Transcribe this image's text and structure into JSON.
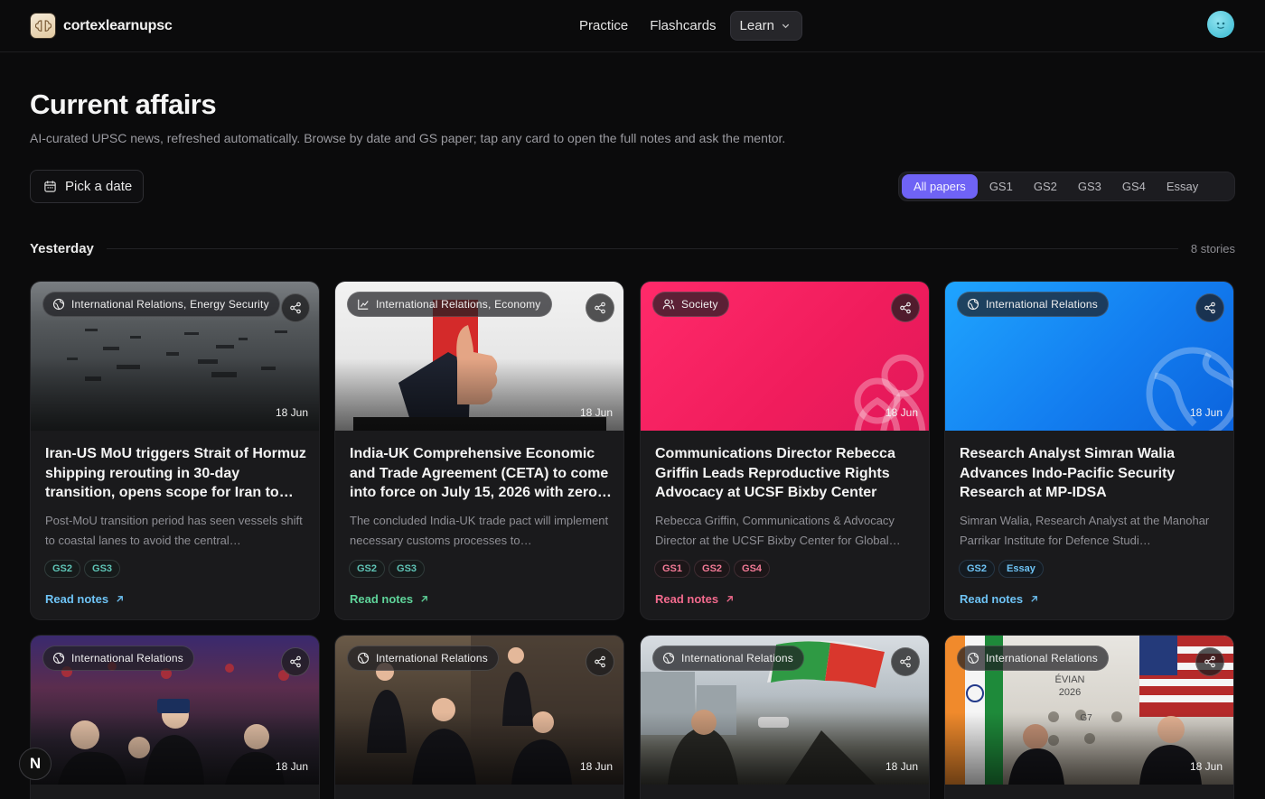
{
  "nav": {
    "brand": "cortexlearnupsc",
    "items": [
      "Practice",
      "Flashcards"
    ],
    "learn_label": "Learn"
  },
  "header": {
    "title": "Current affairs",
    "subtitle": "AI-curated UPSC news, refreshed automatically. Browse by date and GS paper; tap any card to open the full notes and ask the mentor.",
    "pick_date": "Pick a date"
  },
  "filters": [
    "All papers",
    "GS1",
    "GS2",
    "GS3",
    "GS4",
    "Essay"
  ],
  "section": {
    "title": "Yesterday",
    "count": "8 stories"
  },
  "cards": [
    {
      "tag": "International Relations, Energy Security",
      "date": "18 Jun",
      "title": "Iran-US MoU triggers Strait of Hormuz shipping rerouting in 30-day transition, opens scope for Iran to…",
      "summary": "Post-MoU transition period has seen vessels shift to coastal lanes to avoid the central…",
      "gs": [
        "GS2",
        "GS3"
      ],
      "read": "Read notes",
      "accent": "#6ec3f5"
    },
    {
      "tag": "International Relations, Economy",
      "date": "18 Jun",
      "title": "India-UK Comprehensive Economic and Trade Agreement (CETA) to come into force on July 15, 2026 with zero…",
      "summary": "The concluded India-UK trade pact will implement necessary customs processes to…",
      "gs": [
        "GS2",
        "GS3"
      ],
      "read": "Read notes",
      "accent": "#5fd49a"
    },
    {
      "tag": "Society",
      "date": "18 Jun",
      "title": "Communications Director Rebecca Griffin Leads Reproductive Rights Advocacy at UCSF Bixby Center",
      "summary": "Rebecca Griffin, Communications & Advocacy Director at the UCSF Bixby Center for Global…",
      "gs": [
        "GS1",
        "GS2",
        "GS4"
      ],
      "read": "Read notes",
      "accent": "#f26a8d"
    },
    {
      "tag": "International Relations",
      "date": "18 Jun",
      "title": "Research Analyst Simran Walia Advances Indo-Pacific Security Research at MP-IDSA",
      "summary": "Simran Walia, Research Analyst at the Manohar Parrikar Institute for Defence Studi…",
      "gs": [
        "GS2",
        "Essay"
      ],
      "read": "Read notes",
      "accent": "#6ec3f5"
    },
    {
      "tag": "International Relations",
      "date": "18 Jun"
    },
    {
      "tag": "International Relations",
      "date": "18 Jun"
    },
    {
      "tag": "International Relations",
      "date": "18 Jun"
    },
    {
      "tag": "International Relations",
      "date": "18 Jun",
      "photo_text": [
        "ÉVIAN",
        "2026",
        "G7"
      ]
    }
  ],
  "n_badge": "N"
}
